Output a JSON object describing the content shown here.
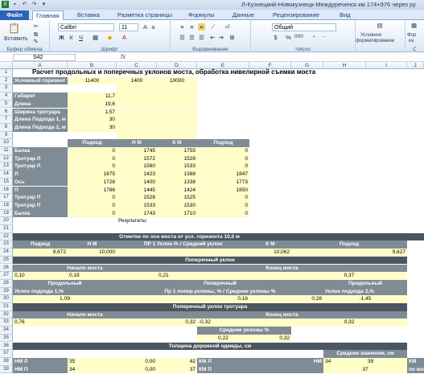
{
  "window": {
    "title": "Л-Кузнецкий-Новокузнецк-Междуреченск км 174+976 через ру"
  },
  "ribbon": {
    "tabs": [
      "Файл",
      "Главная",
      "Вставка",
      "Разметка страницы",
      "Формулы",
      "Данные",
      "Рецензирование",
      "Вид"
    ],
    "paste": "Вставить",
    "clipboard": "Буфер обмена",
    "font_name": "Calibri",
    "font_size": "11",
    "font_group": "Шрифт",
    "align_group": "Выравнивание",
    "number_format": "Общий",
    "number_group": "Число",
    "cond_format": "Условное форматирование",
    "cond_fmt_1": "Условное",
    "cond_fmt_2": "форматирование",
    "percent": "%",
    "thousands": "000",
    "format_as": "Фор",
    "format_as_2": "ка",
    "styles": "С"
  },
  "formula": {
    "cell": "S42",
    "fx": "fx"
  },
  "columns": [
    "A",
    "B",
    "C",
    "D",
    "E",
    "F",
    "G",
    "H",
    "I",
    "J"
  ],
  "rows": [
    "1",
    "2",
    "3",
    "4",
    "5",
    "6",
    "7",
    "8",
    "9",
    "10",
    "11",
    "12",
    "13",
    "14",
    "15",
    "16",
    "17",
    "18",
    "19",
    "20",
    "21",
    "22",
    "23",
    "24",
    "25",
    "26",
    "27",
    "28",
    "29",
    "30",
    "31",
    "32",
    "33",
    "34",
    "35",
    "36",
    "37",
    "38",
    "39"
  ],
  "sheet": {
    "title": "Расчет продольных и поперечных уклонов моста, обработка нивелирной съемки моста",
    "r2": [
      "Условный горизонт",
      "11400",
      "1400",
      "10000"
    ],
    "params": [
      [
        "Габарит",
        "11,7"
      ],
      [
        "Длина",
        "19,6"
      ],
      [
        "Ширина тротуара",
        "1,57"
      ],
      [
        "Длина Подхода 1, м",
        "30"
      ],
      [
        "Длина Подхода 2, м",
        "30"
      ]
    ],
    "hdr10": [
      "Подход",
      "Н М",
      "К М",
      "Подход"
    ],
    "table": [
      [
        "Балка",
        "0",
        "1745",
        "1755",
        "0"
      ],
      [
        "Тротуар Л",
        "0",
        "1572",
        "1528",
        "0"
      ],
      [
        "Тротуар Л",
        "0",
        "1560",
        "1533",
        "0"
      ],
      [
        "Л",
        "1875",
        "1423",
        "1388",
        "1847"
      ],
      [
        "Ось",
        "1728",
        "1400",
        "1338",
        "1773"
      ],
      [
        "П",
        "1786",
        "1445",
        "1424",
        "1850"
      ],
      [
        "Тротуар П",
        "0",
        "1528",
        "1525",
        "0"
      ],
      [
        "Тротуар П",
        "0",
        "1533",
        "1530",
        "0"
      ],
      [
        "Балка",
        "0",
        "1743",
        "1710",
        "0"
      ]
    ],
    "results": "Результаты:",
    "r22": "Отметки по оси моста от усл. горизонта 10,0 м",
    "r22h": [
      "Подход",
      "Н М",
      "ПР 1 Уклон % / Средний уклон",
      "К М",
      "Подход"
    ],
    "r23": [
      "9,672",
      "10,000",
      "10,062",
      "9,627"
    ],
    "r24": "Поперечный уклон",
    "r25": [
      "Начало моста",
      "Конец моста"
    ],
    "r26": [
      "0,10",
      "0,19",
      "0,21",
      "0,37"
    ],
    "r27": [
      "Продольный",
      "Поперечный",
      "Продольный"
    ],
    "r28": [
      "Уклон подхода 1,%",
      "Пр 1 попер.уклоны, % / Средние уклоны %",
      "Уклон подхода 2,%"
    ],
    "r29": [
      "1,09",
      "0,16",
      "0,28",
      "-1,45"
    ],
    "r30": "Поперечный уклон тротуара",
    "r31": [
      "Начало моста",
      "Конец моста"
    ],
    "r32": [
      "0,76",
      "0,32",
      "-0,32",
      "0,32"
    ],
    "r33": "Средние уклоны %",
    "r34": [
      "0,22",
      "0,32"
    ],
    "r36": "Толщина дорожной одежды, см",
    "r36b": "Средние значения, см",
    "r37": [
      "НМ Л",
      "35",
      "0,00",
      "42",
      "КМ Л",
      "НМ",
      "34",
      "39",
      "КМ"
    ],
    "r38": [
      "НМ П",
      "34",
      "0,00",
      "37",
      "КМ П",
      "37",
      "по мосту"
    ]
  }
}
